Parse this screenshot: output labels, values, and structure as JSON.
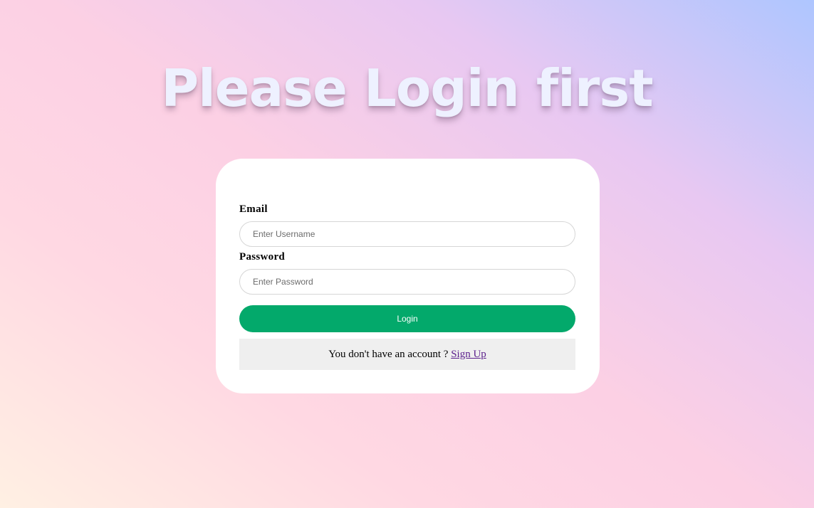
{
  "page": {
    "title": "Please Login first"
  },
  "form": {
    "email": {
      "label": "Email",
      "placeholder": "Enter Username"
    },
    "password": {
      "label": "Password",
      "placeholder": "Enter Password"
    },
    "login_button": "Login",
    "signup_prompt": "You don't have an account ?",
    "signup_link": "Sign Up"
  },
  "colors": {
    "login_button": "#03a96b",
    "link": "#5b1f8c",
    "card_background": "#ffffff",
    "signup_box_background": "#efefef"
  }
}
